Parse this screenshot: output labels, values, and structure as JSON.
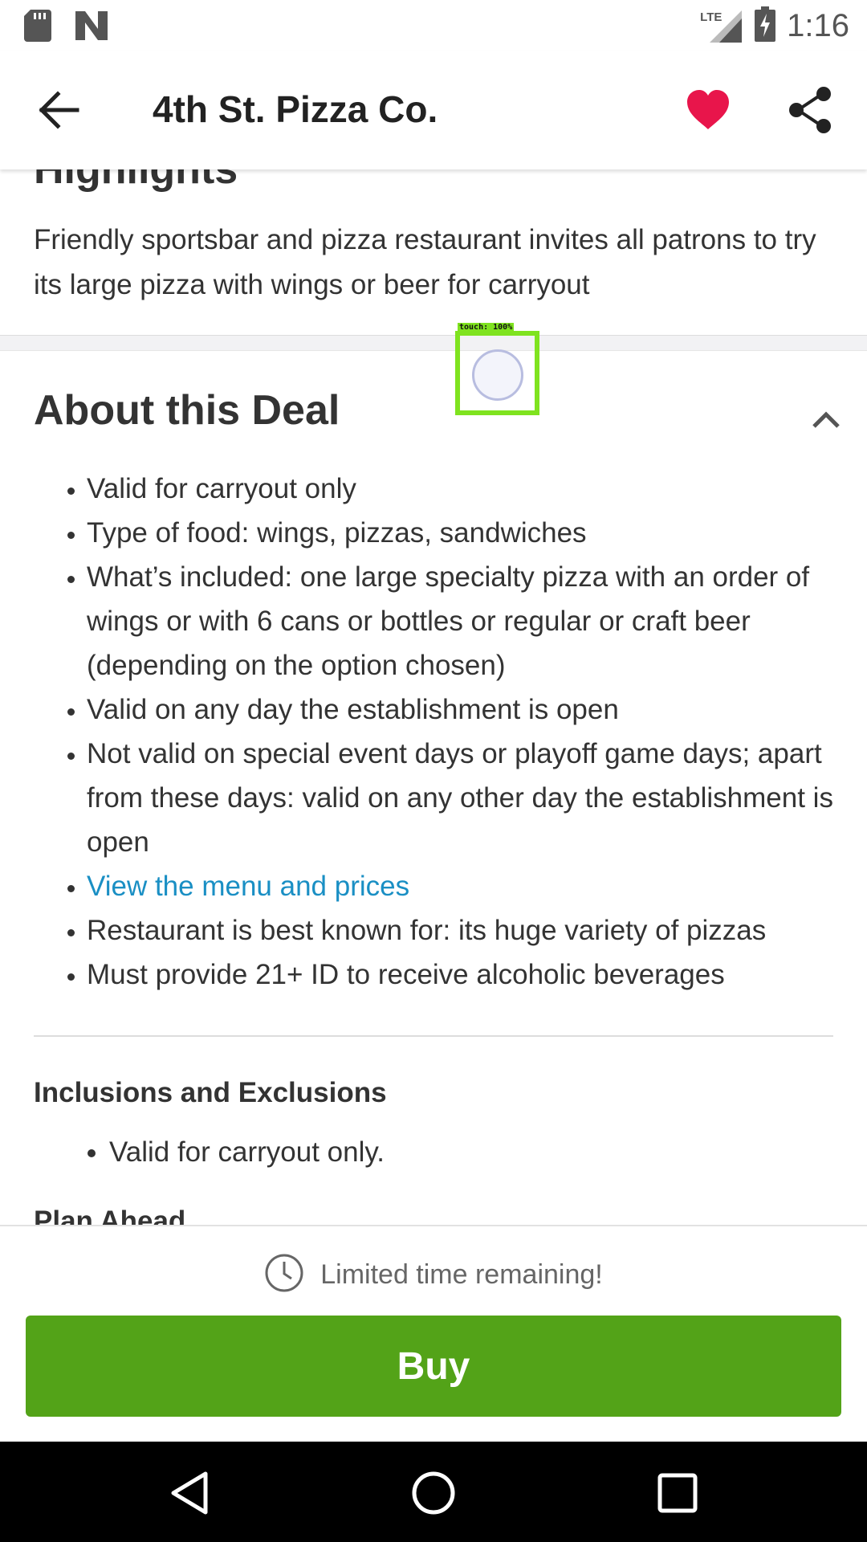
{
  "status_bar": {
    "time": "1:16",
    "network_label": "LTE",
    "icons": [
      "sd-card-icon",
      "n-icon",
      "lte-signal-icon",
      "battery-charging-icon"
    ]
  },
  "app_bar": {
    "title": "4th St. Pizza Co.",
    "icons": [
      "back-arrow-icon",
      "heart-icon",
      "share-icon"
    ],
    "favorite_color": "#e8154b"
  },
  "highlights": {
    "heading": "Highlights",
    "text": "Friendly sportsbar and pizza restaurant invites all patrons to try its large pizza with wings or beer for carryout"
  },
  "about": {
    "heading": "About this Deal",
    "items": [
      "Valid for carryout only",
      "Type of food: wings, pizzas, sandwiches",
      "What’s included: one large specialty pizza with an order of wings or with 6 cans or bottles or regular or craft beer (depending on the option chosen)",
      "Valid on any day the establishment is open",
      "Not valid on special event days or playoff game days; apart from these days: valid on any other day the establishment is open",
      "View the menu and prices",
      "Restaurant is best known for: its huge variety of pizzas",
      "Must provide 21+ ID to receive alcoholic beverages"
    ],
    "link_color": "#1a8fc4"
  },
  "inclusions": {
    "heading": "Inclusions and Exclusions",
    "items": [
      "Valid for carryout only."
    ]
  },
  "plan_ahead": {
    "heading": "Plan Ahead"
  },
  "touch_indicator": {
    "label": "touch: 100%"
  },
  "bottom_bar": {
    "timer_text": "Limited time remaining!",
    "buy_label": "Buy",
    "buy_color": "#53a318"
  },
  "nav_bar": {
    "icons": [
      "back-triangle-icon",
      "home-circle-icon",
      "recents-square-icon"
    ]
  }
}
